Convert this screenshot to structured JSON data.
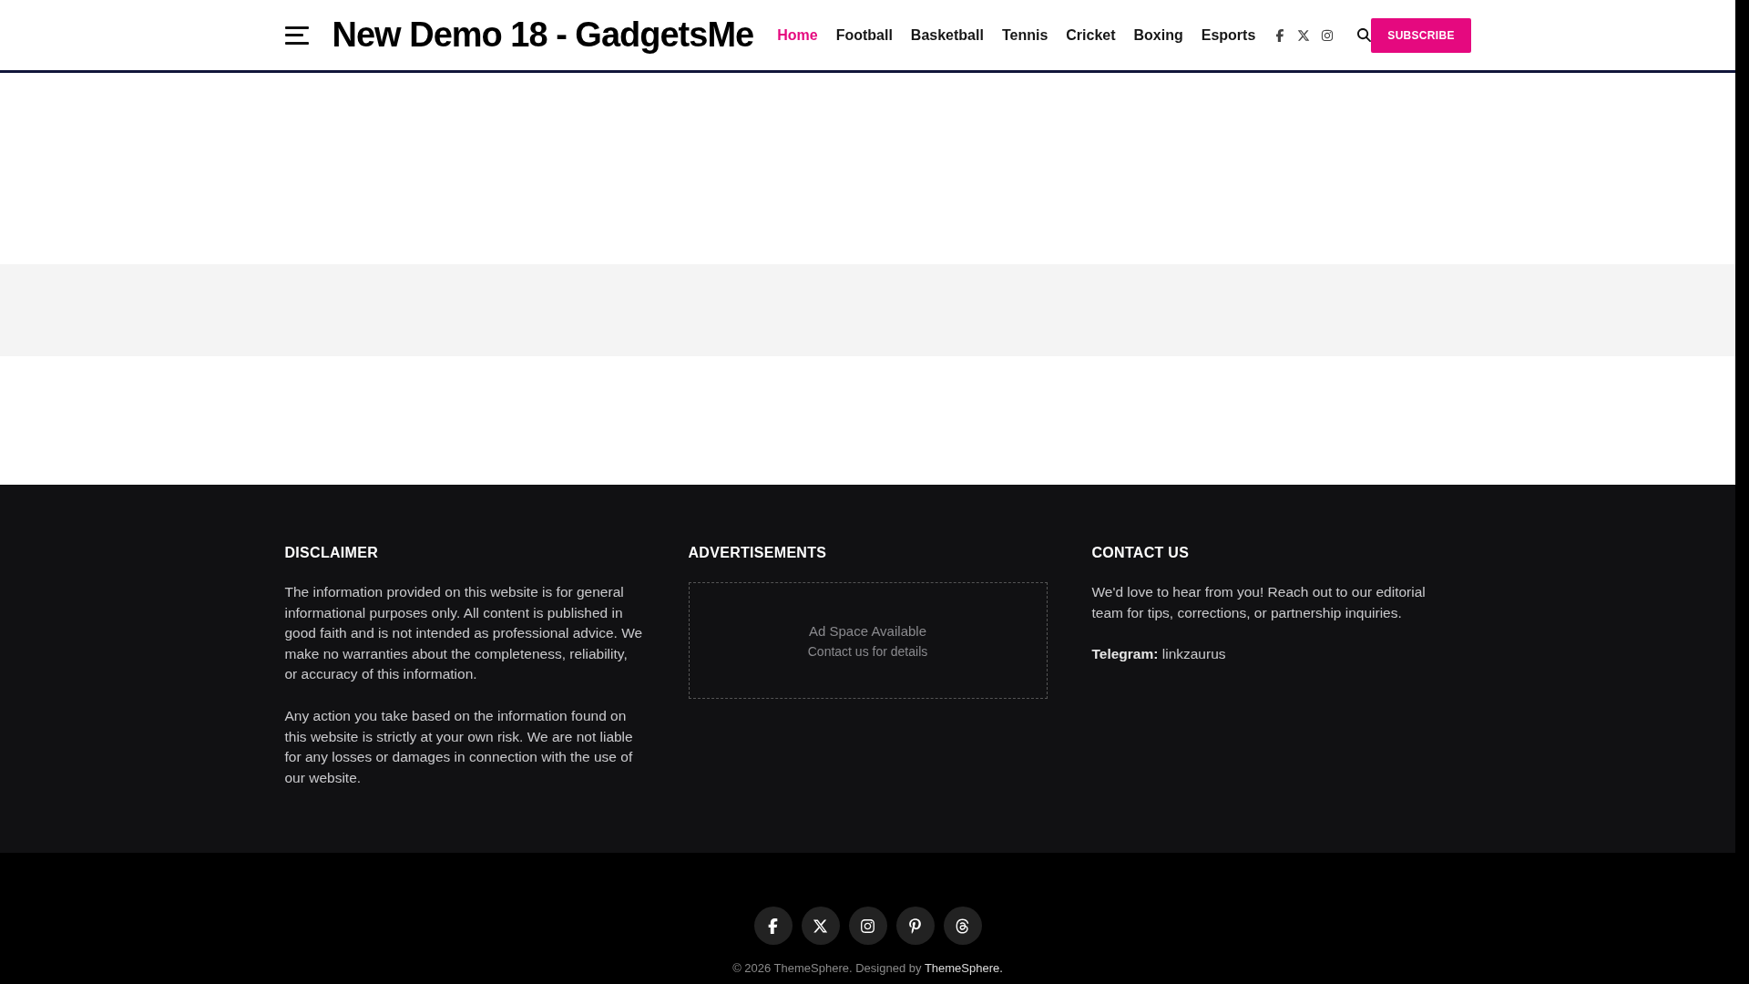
{
  "header": {
    "site_title": "New Demo 18 - GadgetsMe",
    "nav": [
      {
        "label": "Home",
        "selected": true
      },
      {
        "label": "Football",
        "selected": false
      },
      {
        "label": "Basketball",
        "selected": false
      },
      {
        "label": "Tennis",
        "selected": false
      },
      {
        "label": "Cricket",
        "selected": false
      },
      {
        "label": "Boxing",
        "selected": false
      },
      {
        "label": "Esports",
        "selected": false
      }
    ],
    "social": [
      {
        "kind": "facebook"
      },
      {
        "kind": "x"
      },
      {
        "kind": "instagram"
      }
    ],
    "subscribe": "SUBSCRIBE"
  },
  "footer": {
    "columns": [
      {
        "kind": "text",
        "heading": "DISCLAIMER",
        "paragraphs": [
          "The information provided on this website is for general informational purposes only. All content is published in good faith and is not intended as professional advice. We make no warranties about the completeness, reliability, or accuracy of this information.",
          "Any action you take based on the information found on this website is strictly at your own risk. We are not liable for any losses or damages in connection with the use of our website."
        ]
      },
      {
        "kind": "ad",
        "heading": "ADVERTISEMENTS",
        "ad_title": "Ad Space Available",
        "ad_subtitle": "Contact us for details"
      },
      {
        "kind": "text",
        "heading": "CONTACT US",
        "paragraphs": [
          "We'd love to hear from you! Reach out to our editorial team for tips, corrections, or partnership inquiries.",
          "**Telegram:** linkzaurus"
        ]
      }
    ],
    "social": [
      {
        "kind": "facebook"
      },
      {
        "kind": "x"
      },
      {
        "kind": "instagram"
      },
      {
        "kind": "pinterest"
      },
      {
        "kind": "threads"
      }
    ],
    "copyright": "© 2026 ThemeSphere. Designed by",
    "credit_link": "ThemeSphere."
  }
}
